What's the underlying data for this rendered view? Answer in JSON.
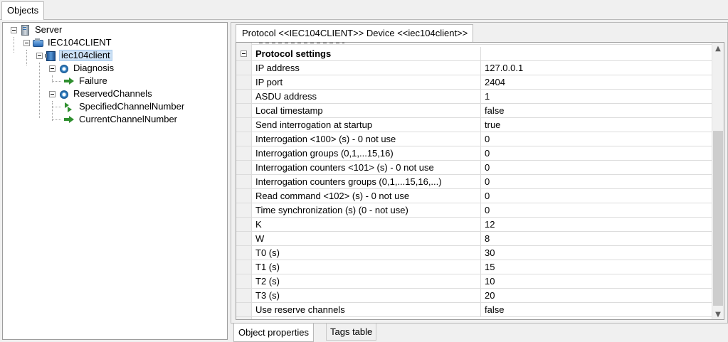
{
  "top_tabs": {
    "objects": "Objects"
  },
  "tree": {
    "server": "Server",
    "client": "IEC104CLIENT",
    "device": "iec104client",
    "diagnosis": "Diagnosis",
    "failure": "Failure",
    "reserved_channels": "ReservedChannels",
    "specified_channel_number": "SpecifiedChannelNumber",
    "current_channel_number": "CurrentChannelNumber"
  },
  "property_tab": {
    "title": "Protocol <<IEC104CLIENT>> Device <<iec104client>>"
  },
  "grid": {
    "category": "Protocol settings",
    "rows": [
      {
        "key": "IP address",
        "value": "127.0.0.1"
      },
      {
        "key": "IP port",
        "value": "2404"
      },
      {
        "key": "ASDU address",
        "value": "1"
      },
      {
        "key": "Local timestamp",
        "value": "false"
      },
      {
        "key": "Send interrogation at startup",
        "value": "true"
      },
      {
        "key": "Interrogation <100> (s) - 0 not use",
        "value": "0"
      },
      {
        "key": "Interrogation groups (0,1,...15,16)",
        "value": "0"
      },
      {
        "key": "Interrogation counters <101> (s) - 0 not use",
        "value": "0"
      },
      {
        "key": "Interrogation counters groups (0,1,...15,16,...)",
        "value": "0"
      },
      {
        "key": "Read command <102> (s) - 0 not use",
        "value": "0"
      },
      {
        "key": "Time synchronization (s) (0 - not use)",
        "value": "0"
      },
      {
        "key": "K",
        "value": "12"
      },
      {
        "key": "W",
        "value": "8"
      },
      {
        "key": "T0 (s)",
        "value": "30"
      },
      {
        "key": "T1 (s)",
        "value": "15"
      },
      {
        "key": "T2 (s)",
        "value": "10"
      },
      {
        "key": "T3 (s)",
        "value": "20"
      },
      {
        "key": "Use reserve channels",
        "value": "false"
      }
    ]
  },
  "scrollbar": {
    "up": "▲",
    "down": "▼"
  },
  "bottom_tabs": {
    "object_properties": "Object properties",
    "tags_table": "Tags table"
  },
  "icons": {
    "server": "server-icon",
    "client": "iec104-client-icon",
    "device": "device-icon",
    "group": "gear-folder-icon",
    "output": "arrow-right-icon",
    "bidirectional": "arrows-swap-icon"
  },
  "colors": {
    "selection": "#cce1f5",
    "panel": "#f0f0f0",
    "grid_line": "#dcdcdc"
  }
}
